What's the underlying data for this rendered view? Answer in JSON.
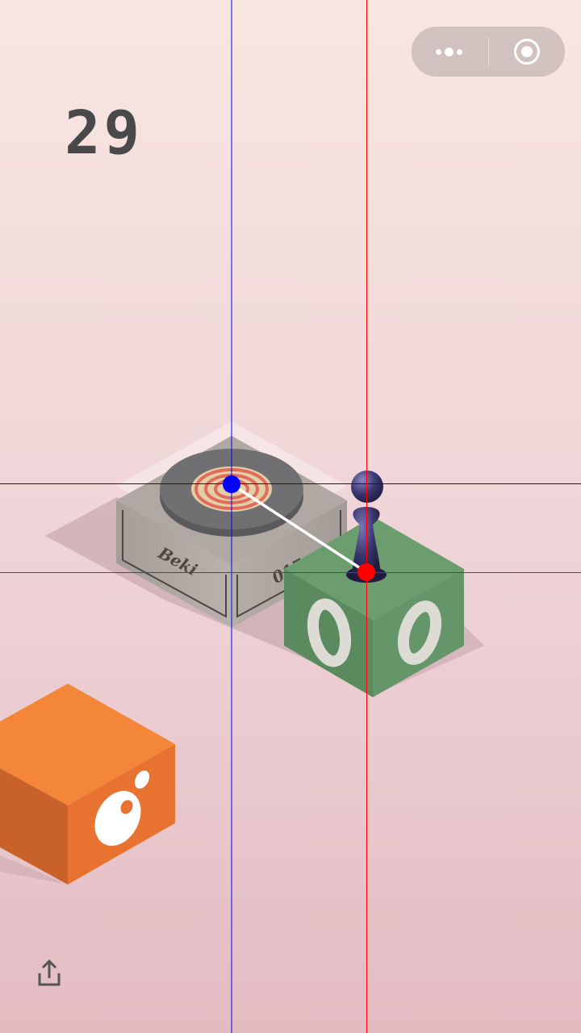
{
  "game": {
    "score": "29"
  },
  "capsule_menu": {
    "more_icon": "more-dots-icon",
    "close_icon": "target-close-icon"
  },
  "share": {
    "icon": "share-icon"
  },
  "colors": {
    "background_top": "#f8e6e0",
    "background_bottom": "#e3bcc2",
    "score_text": "#494949",
    "wood_box": "#aba49e",
    "turntable": "#6e6e70",
    "target_red": "#e26b5e",
    "green_cube": "#6a9b6d",
    "orange_cube": "#f4863a",
    "player_piece": "#2f2c5a",
    "aim_line": "#ffffff",
    "crosshair_blue": "#0000ff",
    "crosshair_red": "#ff0000"
  },
  "box_label": {
    "left_face_text": "Beki",
    "right_face_text": "017"
  }
}
